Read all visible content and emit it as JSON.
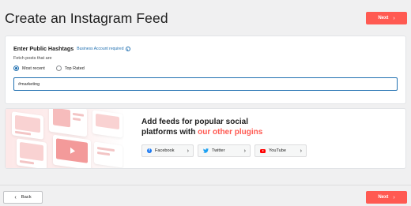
{
  "header": {
    "title": "Create an Instagram Feed",
    "next_label": "Next"
  },
  "hashtags": {
    "title": "Enter Public Hashtags",
    "requirement": "Business Account required",
    "fetch_label": "Fetch posts that are",
    "options": [
      {
        "label": "Most recent",
        "selected": true
      },
      {
        "label": "Top Rated",
        "selected": false
      }
    ],
    "input_value": "#marketing"
  },
  "promo": {
    "heading_line1": "Add feeds for popular social",
    "heading_line2_prefix": "platforms with ",
    "heading_line2_accent": "our other plugins",
    "accent_color": "#ff5a52",
    "buttons": [
      {
        "label": "Facebook",
        "icon": "facebook-icon"
      },
      {
        "label": "Twitter",
        "icon": "twitter-icon"
      },
      {
        "label": "YouTube",
        "icon": "youtube-icon"
      }
    ]
  },
  "footer": {
    "back_label": "Back",
    "next_label": "Next"
  }
}
